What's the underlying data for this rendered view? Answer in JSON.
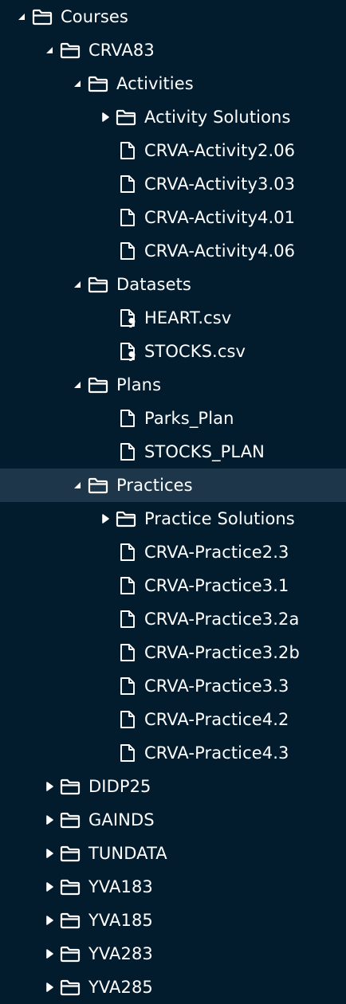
{
  "tree": {
    "rows": [
      {
        "label": "Courses",
        "kind": "folder",
        "expanded": true,
        "depth": 0
      },
      {
        "label": "CRVA83",
        "kind": "folder",
        "expanded": true,
        "depth": 1
      },
      {
        "label": "Activities",
        "kind": "folder",
        "expanded": true,
        "depth": 2
      },
      {
        "label": "Activity Solutions",
        "kind": "folder",
        "expanded": false,
        "depth": 3
      },
      {
        "label": "CRVA-Activity2.06",
        "kind": "file",
        "depth": 3
      },
      {
        "label": "CRVA-Activity3.03",
        "kind": "file",
        "depth": 3
      },
      {
        "label": "CRVA-Activity4.01",
        "kind": "file",
        "depth": 3
      },
      {
        "label": "CRVA-Activity4.06",
        "kind": "file",
        "depth": 3
      },
      {
        "label": "Datasets",
        "kind": "folder",
        "expanded": true,
        "depth": 2
      },
      {
        "label": "HEART.csv",
        "kind": "csv",
        "depth": 3
      },
      {
        "label": "STOCKS.csv",
        "kind": "csv",
        "depth": 3
      },
      {
        "label": "Plans",
        "kind": "folder",
        "expanded": true,
        "depth": 2
      },
      {
        "label": "Parks_Plan",
        "kind": "file",
        "depth": 3
      },
      {
        "label": "STOCKS_PLAN",
        "kind": "file",
        "depth": 3
      },
      {
        "label": "Practices",
        "kind": "folder",
        "expanded": true,
        "depth": 2,
        "selected": true
      },
      {
        "label": "Practice Solutions",
        "kind": "folder",
        "expanded": false,
        "depth": 3
      },
      {
        "label": "CRVA-Practice2.3",
        "kind": "file",
        "depth": 3
      },
      {
        "label": "CRVA-Practice3.1",
        "kind": "file",
        "depth": 3
      },
      {
        "label": "CRVA-Practice3.2a",
        "kind": "file",
        "depth": 3
      },
      {
        "label": "CRVA-Practice3.2b",
        "kind": "file",
        "depth": 3
      },
      {
        "label": "CRVA-Practice3.3",
        "kind": "file",
        "depth": 3
      },
      {
        "label": "CRVA-Practice4.2",
        "kind": "file",
        "depth": 3
      },
      {
        "label": "CRVA-Practice4.3",
        "kind": "file",
        "depth": 3
      },
      {
        "label": "DIDP25",
        "kind": "folder",
        "expanded": false,
        "depth": 1
      },
      {
        "label": "GAINDS",
        "kind": "folder",
        "expanded": false,
        "depth": 1
      },
      {
        "label": "TUNDATA",
        "kind": "folder",
        "expanded": false,
        "depth": 1
      },
      {
        "label": "YVA183",
        "kind": "folder",
        "expanded": false,
        "depth": 1
      },
      {
        "label": "YVA185",
        "kind": "folder",
        "expanded": false,
        "depth": 1
      },
      {
        "label": "YVA283",
        "kind": "folder",
        "expanded": false,
        "depth": 1
      },
      {
        "label": "YVA285",
        "kind": "folder",
        "expanded": false,
        "depth": 1
      }
    ]
  },
  "colors": {
    "background": "#021c2e",
    "selected_row": "#1e3649",
    "text": "#ffffff",
    "icon": "#ffffff"
  },
  "icons": {
    "folder": "folder-icon",
    "file": "file-icon",
    "csv": "csv-file-icon",
    "expanded": "triangle-down-icon",
    "collapsed": "triangle-right-icon"
  }
}
